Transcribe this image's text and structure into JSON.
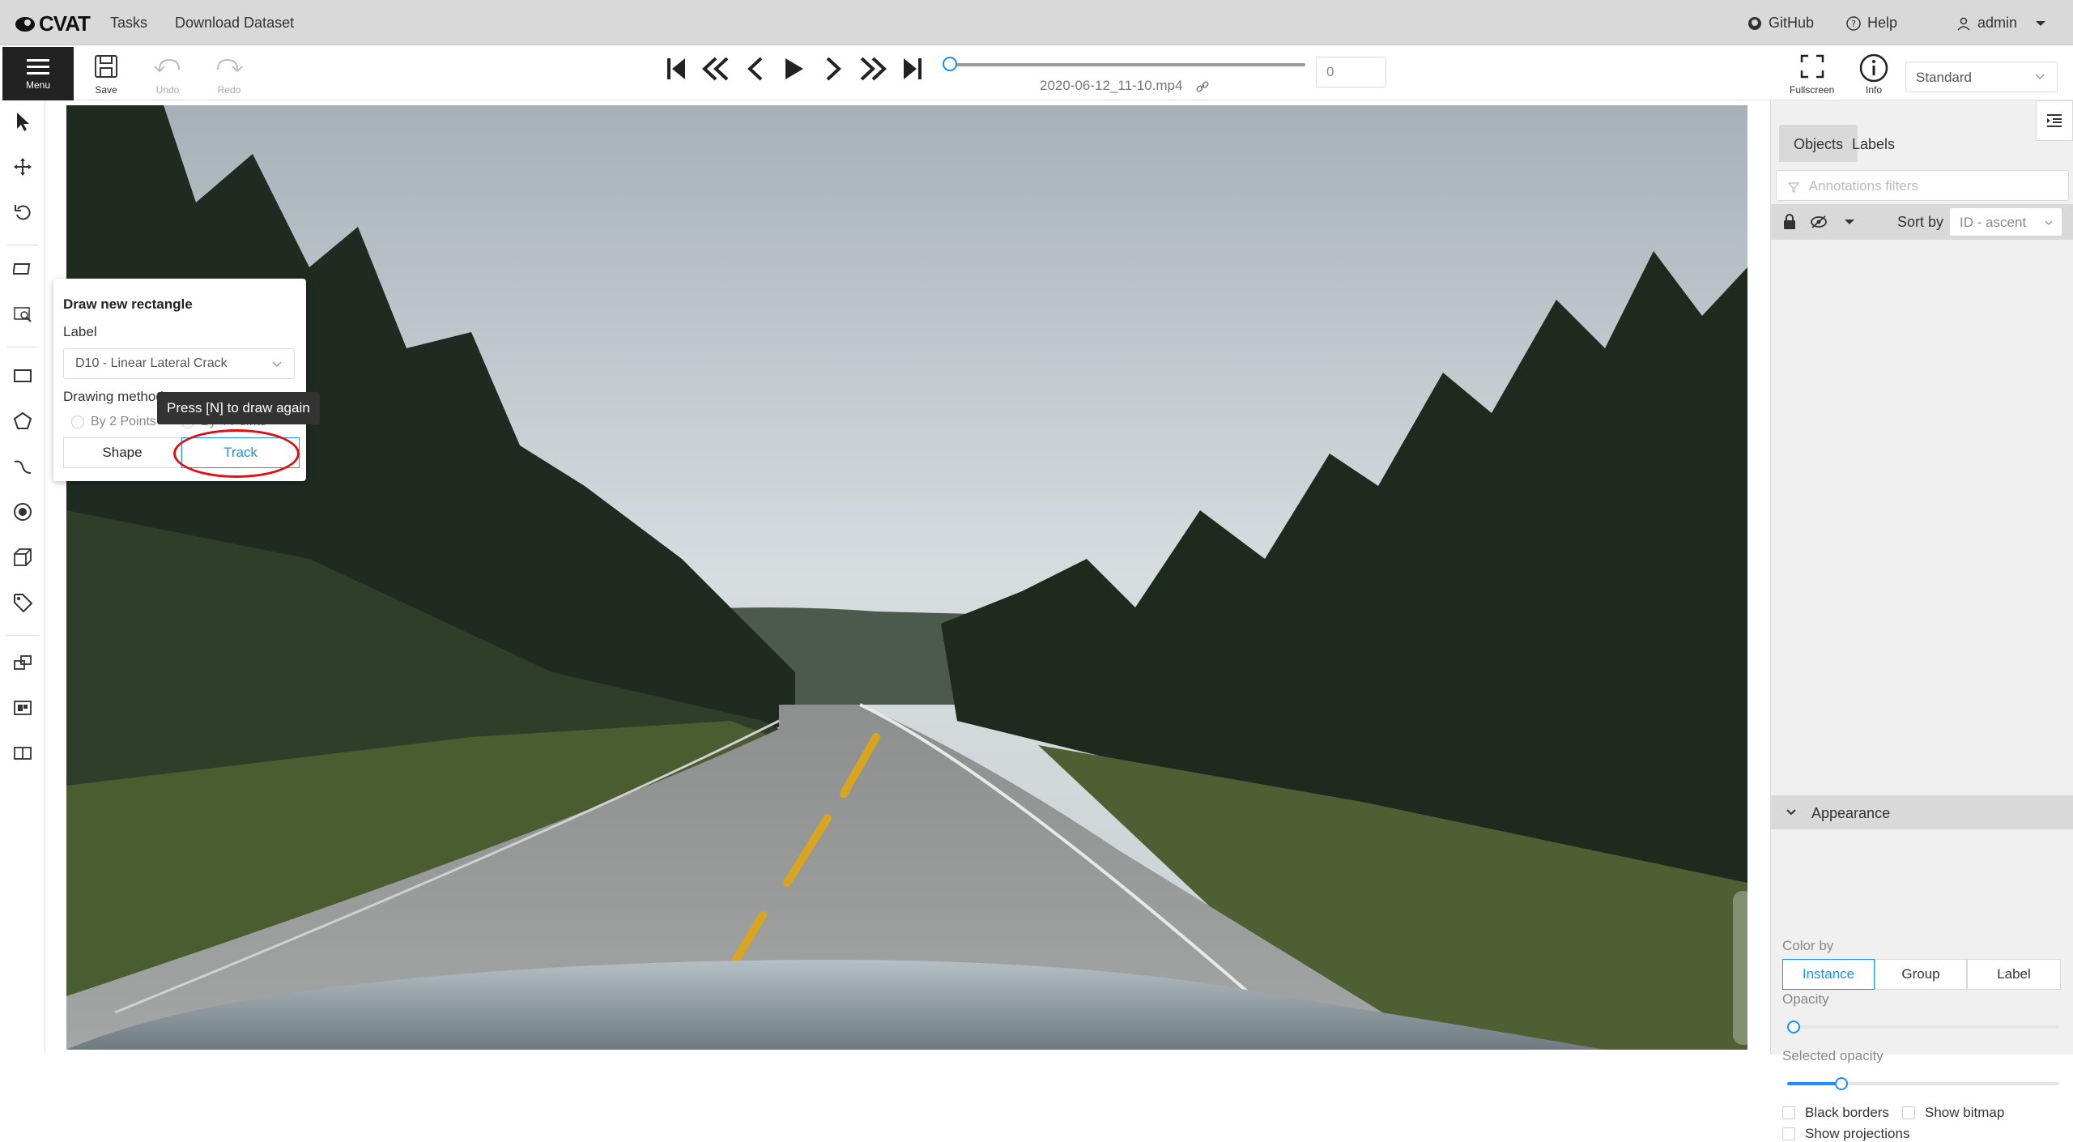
{
  "header": {
    "logo_text": "CVAT",
    "nav": [
      "Tasks",
      "Download Dataset"
    ],
    "github": "GitHub",
    "help": "Help",
    "user": "admin"
  },
  "toolbar": {
    "menu_label": "Menu",
    "save_label": "Save",
    "undo_label": "Undo",
    "redo_label": "Redo",
    "filename": "2020-06-12_11-10.mp4",
    "frame_number": "0",
    "fullscreen_label": "Fullscreen",
    "info_label": "Info",
    "workspace": "Standard"
  },
  "draw_popover": {
    "title": "Draw new rectangle",
    "label_heading": "Label",
    "label_value": "D10 - Linear Lateral Crack",
    "method_heading": "Drawing method",
    "method_option_1": "By 2 Points",
    "method_option_2": "By 4 Points",
    "shape_button": "Shape",
    "track_button": "Track"
  },
  "tooltip": "Press [N] to draw again",
  "sidebar": {
    "tabs": [
      "Objects",
      "Labels"
    ],
    "filter_placeholder": "Annotations filters",
    "sort_label": "Sort by",
    "sort_value": "ID - ascent",
    "appearance_title": "Appearance",
    "color_by_label": "Color by",
    "color_by_options": [
      "Instance",
      "Group",
      "Label"
    ],
    "color_by_selected": "Instance",
    "opacity_label": "Opacity",
    "opacity_value": 0,
    "selected_opacity_label": "Selected opacity",
    "selected_opacity_value": 0.2,
    "black_borders": "Black borders",
    "show_bitmap": "Show bitmap",
    "show_projections": "Show projections"
  },
  "colors": {
    "accent": "#1890ff",
    "annotation_circle": "#e01010"
  }
}
